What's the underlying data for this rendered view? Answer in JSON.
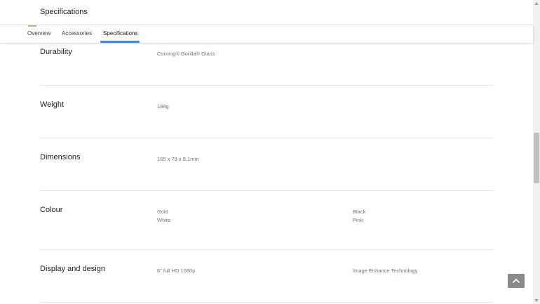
{
  "header": {
    "title": "Specifications"
  },
  "tabs": [
    {
      "label": "Overview"
    },
    {
      "label": "Accessories"
    },
    {
      "label": "Specifications",
      "active": true
    }
  ],
  "specs": [
    {
      "label": "Durability",
      "values": [
        "Corning® Gorilla® Glass"
      ]
    },
    {
      "label": "Weight",
      "values": [
        "188g"
      ]
    },
    {
      "label": "Dimensions",
      "values": [
        "165 x 79 x 8.1mm"
      ]
    },
    {
      "label": "Colour",
      "values": [
        "Gold",
        "White",
        "Black",
        "Pink"
      ]
    },
    {
      "label": "Display and design",
      "values": [
        "6\" full HD 1080p",
        "Image Enhance Technology"
      ]
    }
  ],
  "colors": {
    "accent": "#4285f4",
    "back_to_top_bg": "#8a8a8a"
  },
  "icons": {
    "back_to_top": "chevron-up-icon"
  }
}
